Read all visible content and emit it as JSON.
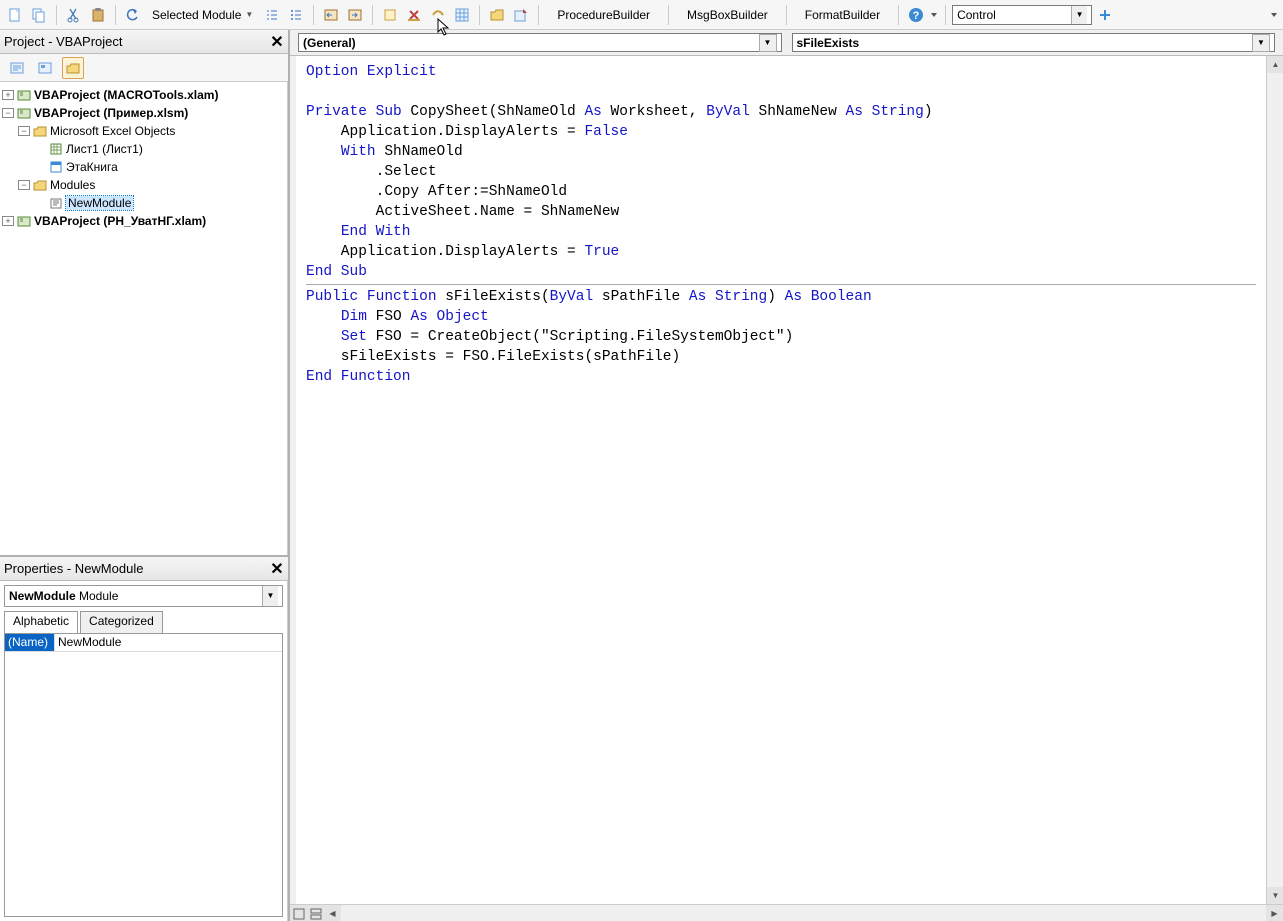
{
  "toolbar": {
    "scope_label": "Selected Module",
    "builders": {
      "procedure": "ProcedureBuilder",
      "msgbox": "MsgBoxBuilder",
      "format": "FormatBuilder"
    },
    "control_combo": "Control"
  },
  "project_panel": {
    "title": "Project - VBAProject",
    "tree": {
      "p1": "VBAProject (MACROTools.xlam)",
      "p2": "VBAProject (Пример.xlsm)",
      "p2_folder1": "Microsoft Excel Objects",
      "p2_sheet1": "Лист1 (Лист1)",
      "p2_workbook": "ЭтаКнига",
      "p2_folder2": "Modules",
      "p2_module": "NewModule",
      "p3": "VBAProject (РН_УватНГ.xlam)"
    }
  },
  "props_panel": {
    "title": "Properties - NewModule",
    "combo_name": "NewModule",
    "combo_type": "Module",
    "tab_alpha": "Alphabetic",
    "tab_cat": "Categorized",
    "row_name_label": "(Name)",
    "row_name_value": "NewModule"
  },
  "code": {
    "object_combo": "(General)",
    "proc_combo": "sFileExists",
    "lines": [
      {
        "t": [
          [
            "kw",
            "Option Explicit"
          ]
        ]
      },
      {
        "t": []
      },
      {
        "t": [
          [
            "kw",
            "Private Sub"
          ],
          [
            "id",
            " CopySheet(ShNameOld "
          ],
          [
            "kw",
            "As"
          ],
          [
            "id",
            " Worksheet, "
          ],
          [
            "kw",
            "ByVal"
          ],
          [
            "id",
            " ShNameNew "
          ],
          [
            "kw",
            "As String"
          ],
          [
            "id",
            ")"
          ]
        ]
      },
      {
        "t": [
          [
            "id",
            "    Application.DisplayAlerts = "
          ],
          [
            "bool",
            "False"
          ]
        ]
      },
      {
        "t": [
          [
            "id",
            "    "
          ],
          [
            "kw",
            "With"
          ],
          [
            "id",
            " ShNameOld"
          ]
        ]
      },
      {
        "t": [
          [
            "id",
            "        .Select"
          ]
        ]
      },
      {
        "t": [
          [
            "id",
            "        .Copy After:=ShNameOld"
          ]
        ]
      },
      {
        "t": [
          [
            "id",
            "        ActiveSheet.Name = ShNameNew"
          ]
        ]
      },
      {
        "t": [
          [
            "id",
            "    "
          ],
          [
            "kw",
            "End With"
          ]
        ]
      },
      {
        "t": [
          [
            "id",
            "    Application.DisplayAlerts = "
          ],
          [
            "bool",
            "True"
          ]
        ]
      },
      {
        "t": [
          [
            "kw",
            "End Sub"
          ]
        ]
      },
      {
        "hr": true
      },
      {
        "t": [
          [
            "kw",
            "Public Function"
          ],
          [
            "id",
            " sFileExists("
          ],
          [
            "kw",
            "ByVal"
          ],
          [
            "id",
            " sPathFile "
          ],
          [
            "kw",
            "As String"
          ],
          [
            "id",
            ") "
          ],
          [
            "kw",
            "As Boolean"
          ]
        ]
      },
      {
        "t": [
          [
            "id",
            "    "
          ],
          [
            "kw",
            "Dim"
          ],
          [
            "id",
            " FSO "
          ],
          [
            "kw",
            "As Object"
          ]
        ]
      },
      {
        "t": [
          [
            "id",
            "    "
          ],
          [
            "kw",
            "Set"
          ],
          [
            "id",
            " FSO = CreateObject(\"Scripting.FileSystemObject\")"
          ]
        ]
      },
      {
        "t": [
          [
            "id",
            "    sFileExists = FSO.FileExists(sPathFile)"
          ]
        ]
      },
      {
        "t": [
          [
            "kw",
            "End Function"
          ]
        ]
      }
    ]
  }
}
